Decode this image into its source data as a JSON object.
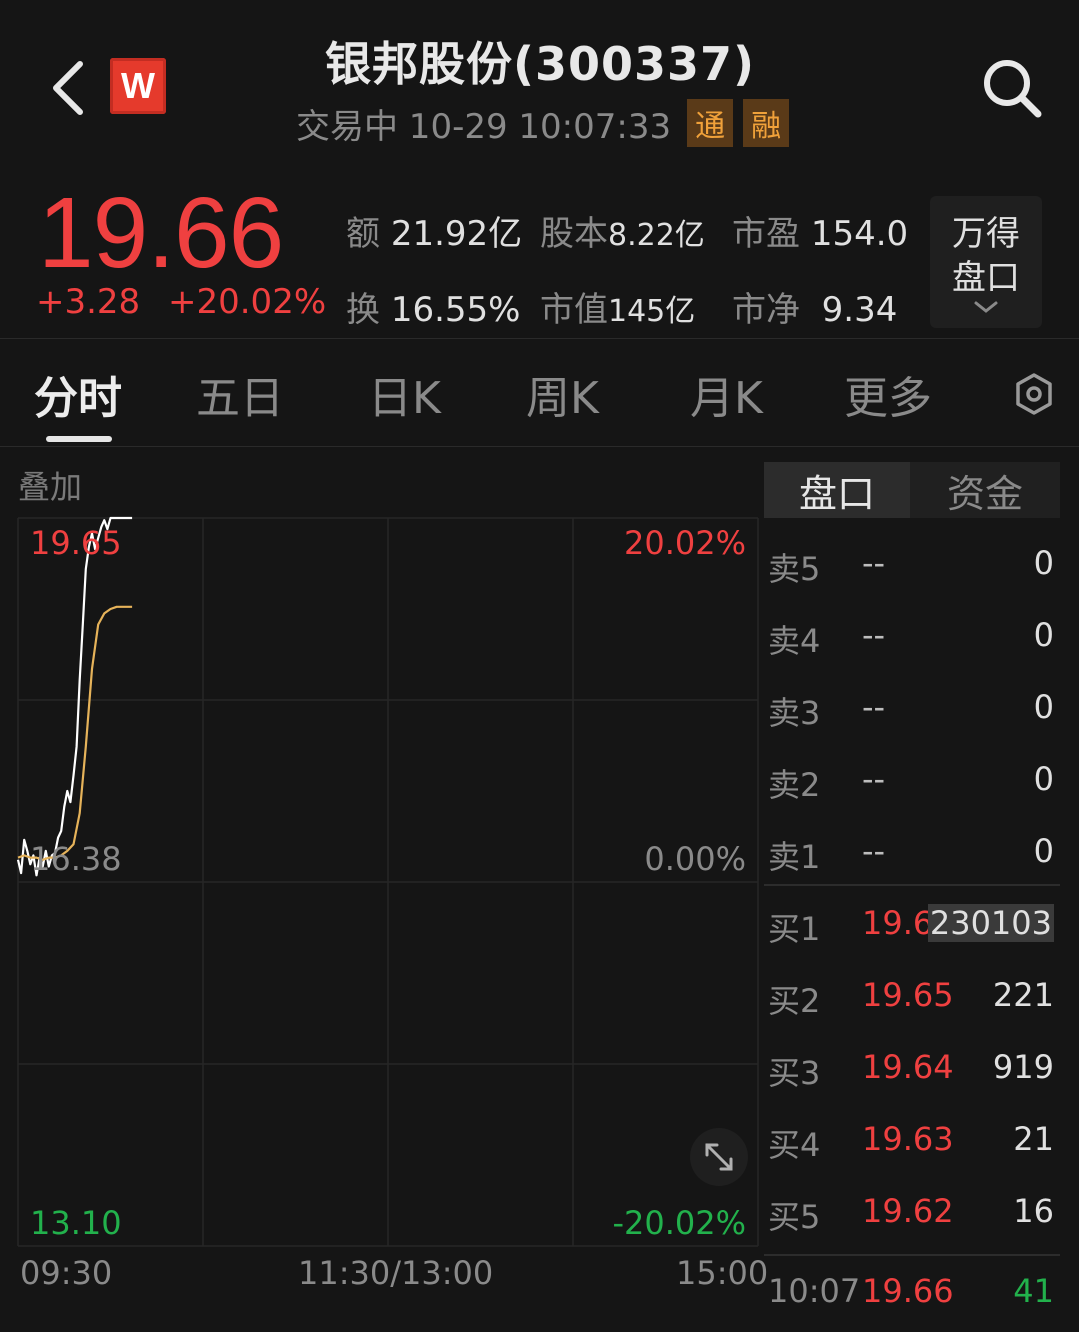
{
  "header": {
    "title": "银邦股份(300337)",
    "status": "交易中 10-29 10:07:33",
    "tags": [
      "通",
      "融"
    ],
    "logo_letter": "W"
  },
  "quote": {
    "price": "19.66",
    "change": "+3.28",
    "change_pct": "+20.02%",
    "stats": [
      {
        "label": "额",
        "value": "21.92亿"
      },
      {
        "label": "股本",
        "value": "8.22亿"
      },
      {
        "label": "市盈",
        "value": "154.0"
      },
      {
        "label": "换",
        "value": "16.55%"
      },
      {
        "label": "市值",
        "value": "145亿"
      },
      {
        "label": "市净",
        "value": "9.34"
      }
    ],
    "wind_button": [
      "万得",
      "盘口"
    ],
    "colors": {
      "up": "#ef4040",
      "down": "#22b14c"
    }
  },
  "tabs": [
    "分时",
    "五日",
    "日K",
    "周K",
    "月K",
    "更多"
  ],
  "chart": {
    "overlay_label": "叠加",
    "price_high": "19.65",
    "price_mid": "16.38",
    "price_low": "13.10",
    "pct_high": "20.02%",
    "pct_mid": "0.00%",
    "pct_low": "-20.02%",
    "time_start": "09:30",
    "time_mid": "11:30/13:00",
    "time_end": "15:00"
  },
  "chart_data": {
    "type": "line",
    "x_unit": "minutes since 09:30",
    "ylim": [
      13.1,
      19.66
    ],
    "series": [
      {
        "color": "#ffffff",
        "x": [
          0,
          1,
          2,
          3,
          4,
          5,
          6,
          7,
          8,
          9,
          10,
          11,
          12,
          13,
          14,
          15,
          16,
          17,
          18,
          19,
          20,
          21,
          22,
          23,
          24,
          25,
          26,
          27,
          28,
          29,
          30,
          31,
          32,
          33,
          34,
          35,
          36,
          37
        ],
        "y": [
          16.58,
          16.46,
          16.76,
          16.66,
          16.54,
          16.62,
          16.44,
          16.6,
          16.52,
          16.66,
          16.52,
          16.62,
          16.64,
          16.78,
          16.84,
          17.06,
          17.2,
          17.1,
          17.34,
          17.6,
          18.2,
          18.7,
          19.2,
          19.4,
          19.52,
          19.38,
          19.48,
          19.58,
          19.64,
          19.56,
          19.66,
          19.66,
          19.66,
          19.66,
          19.66,
          19.66,
          19.66,
          19.66
        ]
      },
      {
        "color": "#e6b35a",
        "x": [
          0,
          2,
          4,
          6,
          8,
          10,
          12,
          14,
          16,
          18,
          20,
          22,
          24,
          26,
          28,
          30,
          32,
          34,
          36,
          37
        ],
        "y": [
          16.6,
          16.62,
          16.6,
          16.6,
          16.58,
          16.6,
          16.6,
          16.62,
          16.66,
          16.72,
          17.0,
          17.6,
          18.3,
          18.7,
          18.8,
          18.84,
          18.86,
          18.86,
          18.86,
          18.86
        ]
      }
    ]
  },
  "orderbook": {
    "tabs": [
      "盘口",
      "资金"
    ],
    "sell": [
      {
        "label": "卖5",
        "price": "--",
        "vol": "0"
      },
      {
        "label": "卖4",
        "price": "--",
        "vol": "0"
      },
      {
        "label": "卖3",
        "price": "--",
        "vol": "0"
      },
      {
        "label": "卖2",
        "price": "--",
        "vol": "0"
      },
      {
        "label": "卖1",
        "price": "--",
        "vol": "0"
      }
    ],
    "buy": [
      {
        "label": "买1",
        "price": "19.66",
        "vol": "230103"
      },
      {
        "label": "买2",
        "price": "19.65",
        "vol": "221"
      },
      {
        "label": "买3",
        "price": "19.64",
        "vol": "919"
      },
      {
        "label": "买4",
        "price": "19.63",
        "vol": "21"
      },
      {
        "label": "买5",
        "price": "19.62",
        "vol": "16"
      }
    ],
    "last_tick": {
      "time": "10:07",
      "price": "19.66",
      "vol": "41"
    }
  }
}
